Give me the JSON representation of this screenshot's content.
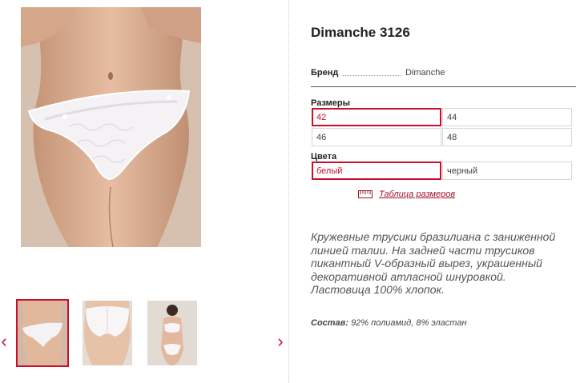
{
  "product": {
    "title": "Dimanche 3126",
    "brand_label": "Бренд",
    "brand_value": "Dimanche"
  },
  "sizes": {
    "label": "Размеры",
    "options": [
      "42",
      "44",
      "46",
      "48"
    ],
    "selected": "42"
  },
  "colors": {
    "label": "Цвета",
    "options": [
      "белый",
      "черный"
    ],
    "selected": "белый"
  },
  "size_table_link": "Таблица размеров",
  "description": "Кружевные трусики бразилиана с заниженной линией талии. На задней части трусиков пикантный V-образный вырез, украшенный декоративной атласной шнуровкой. Ластовица 100% хлопок.",
  "composition": {
    "label": "Состав:",
    "value": "92% полиамид, 8% эластан"
  },
  "gallery": {
    "prev_icon": "chevron-left-icon",
    "next_icon": "chevron-right-icon",
    "thumbnails": [
      "front-view",
      "back-view",
      "full-set-view"
    ],
    "active_index": 0
  },
  "colors_theme": {
    "accent": "#c8102e",
    "text": "#333333"
  }
}
